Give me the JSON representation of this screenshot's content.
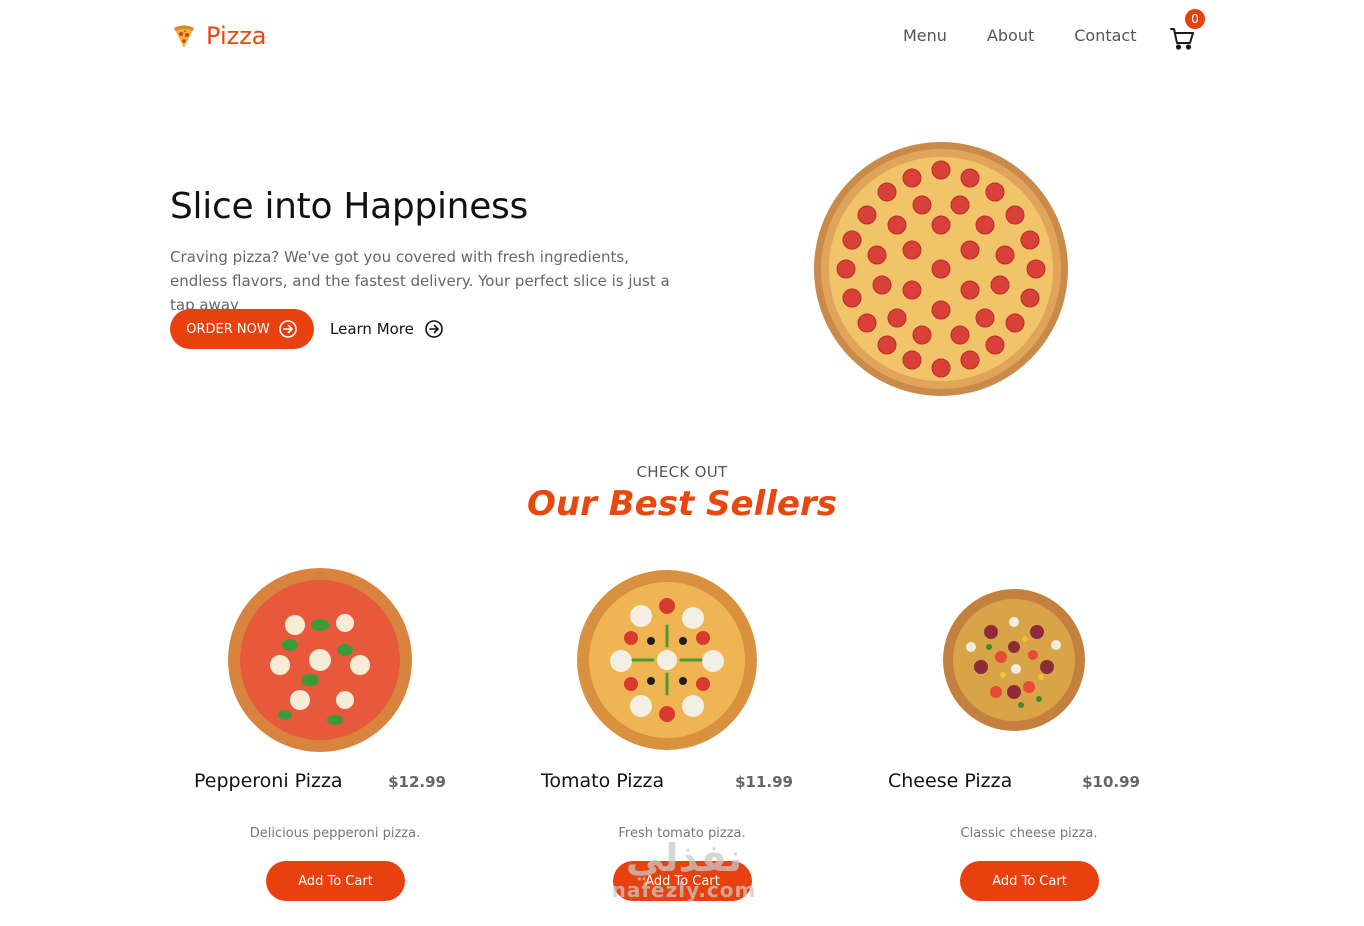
{
  "header": {
    "brand": "Pizza",
    "nav": [
      "Menu",
      "About",
      "Contact"
    ],
    "cart_count": "0"
  },
  "hero": {
    "title": "Slice into Happiness",
    "description": "Craving pizza? We've got you covered with fresh ingredients, endless flavors, and the fastest delivery. Your perfect slice is just a tap away",
    "order_button": "ORDER NOW",
    "learn_button": "Learn More"
  },
  "best_sellers": {
    "kicker": "CHECK OUT",
    "title": "Our Best Sellers",
    "products": [
      {
        "name": "Pepperoni Pizza",
        "price": "$12.99",
        "description": "Delicious pepperoni pizza.",
        "button": "Add To Cart"
      },
      {
        "name": "Tomato Pizza",
        "price": "$11.99",
        "description": "Fresh tomato pizza.",
        "button": "Add To Cart"
      },
      {
        "name": "Cheese Pizza",
        "price": "$10.99",
        "description": "Classic cheese pizza.",
        "button": "Add To Cart"
      }
    ]
  },
  "watermark": {
    "arabic": "نفذلي",
    "latin": "nafezly.com"
  },
  "colors": {
    "accent": "#e8400e",
    "brand": "#e8480e"
  }
}
